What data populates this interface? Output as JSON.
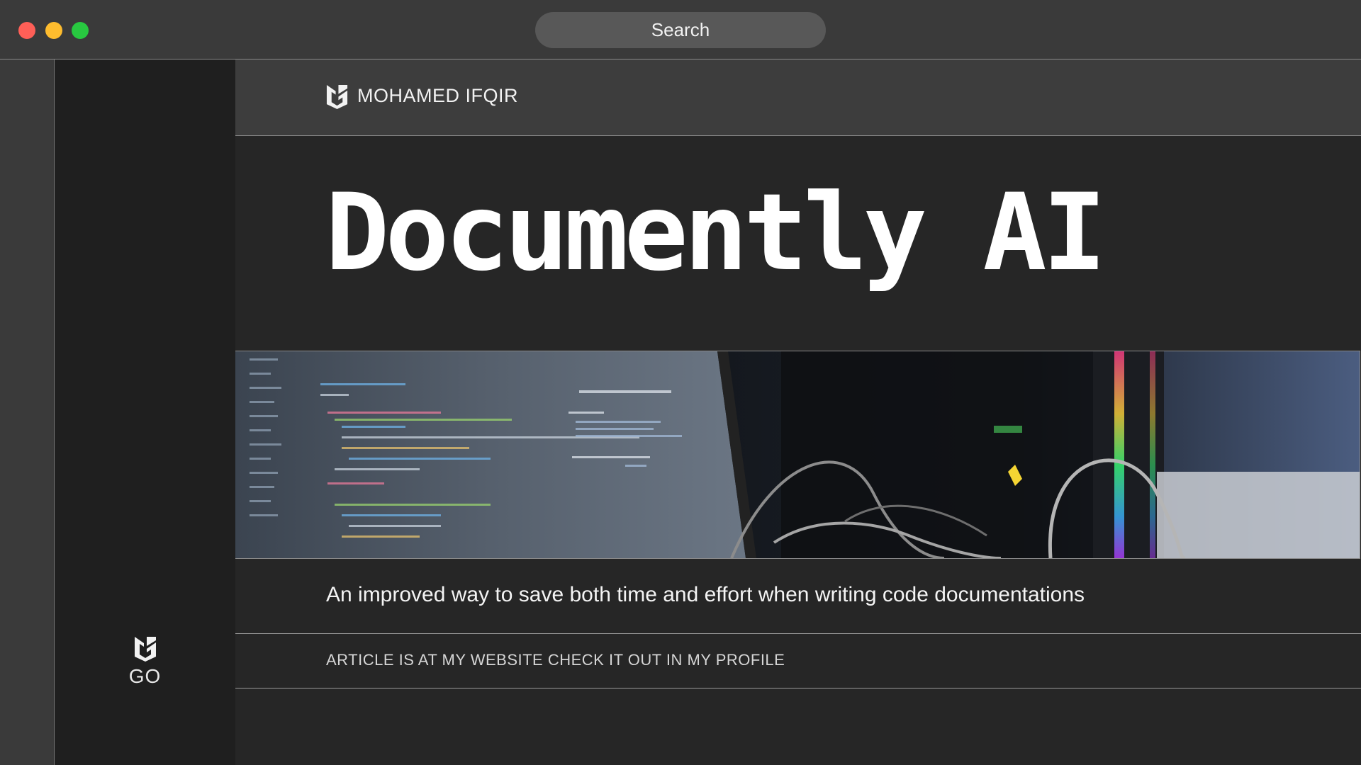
{
  "window": {
    "controls": [
      "close",
      "minimize",
      "maximize"
    ],
    "search_label": "Search"
  },
  "sidebar": {
    "logo_icon": "brand-shield-logo-icon",
    "go_label": "GO"
  },
  "brand": {
    "logo_icon": "brand-shield-logo-icon",
    "name": "MOHAMED IFQIR"
  },
  "hero": {
    "title": "Documently AI",
    "image_alt_icon": "laptop-code-workstation-photo"
  },
  "tagline": "An improved way to save both time and effort when writing code documentations",
  "note": "ARTICLE IS AT MY WEBSITE CHECK IT OUT IN MY PROFILE",
  "colors": {
    "background": "#262626",
    "header": "#3d3d3d",
    "sidebar": "#1f1f1f",
    "close": "#fe5f57",
    "minimize": "#febc2e",
    "maximize": "#28c840"
  }
}
